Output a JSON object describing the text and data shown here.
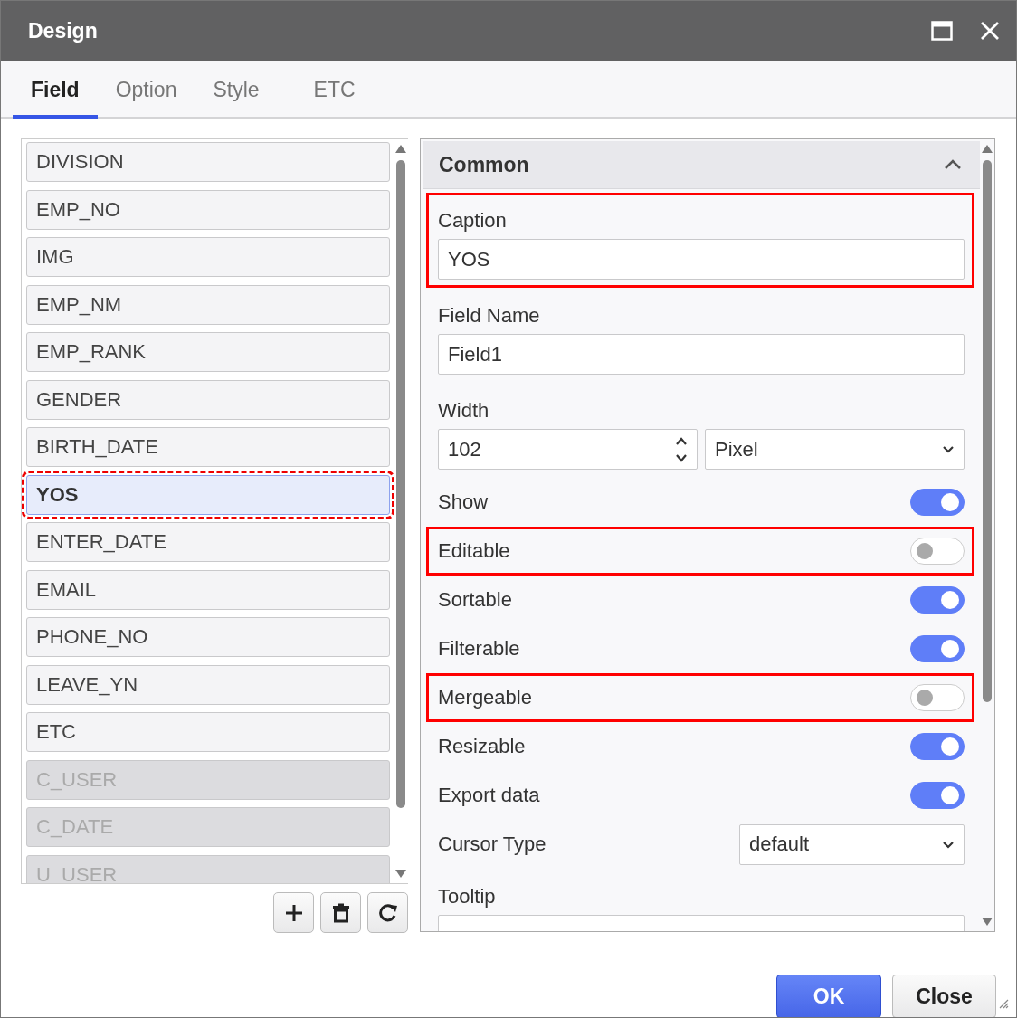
{
  "window": {
    "title": "Design"
  },
  "tabs": [
    {
      "label": "Field",
      "selected": true
    },
    {
      "label": "Option",
      "selected": false
    },
    {
      "label": "Style",
      "selected": false
    },
    {
      "label": "ETC",
      "selected": false
    }
  ],
  "fields": [
    {
      "label": "DIVISION",
      "selected": false,
      "disabled": false,
      "highlighted": false
    },
    {
      "label": "EMP_NO",
      "selected": false,
      "disabled": false,
      "highlighted": false
    },
    {
      "label": "IMG",
      "selected": false,
      "disabled": false,
      "highlighted": false
    },
    {
      "label": "EMP_NM",
      "selected": false,
      "disabled": false,
      "highlighted": false
    },
    {
      "label": "EMP_RANK",
      "selected": false,
      "disabled": false,
      "highlighted": false
    },
    {
      "label": "GENDER",
      "selected": false,
      "disabled": false,
      "highlighted": false
    },
    {
      "label": "BIRTH_DATE",
      "selected": false,
      "disabled": false,
      "highlighted": false
    },
    {
      "label": "YOS",
      "selected": true,
      "disabled": false,
      "highlighted": true
    },
    {
      "label": "ENTER_DATE",
      "selected": false,
      "disabled": false,
      "highlighted": false
    },
    {
      "label": "EMAIL",
      "selected": false,
      "disabled": false,
      "highlighted": false
    },
    {
      "label": "PHONE_NO",
      "selected": false,
      "disabled": false,
      "highlighted": false
    },
    {
      "label": "LEAVE_YN",
      "selected": false,
      "disabled": false,
      "highlighted": false
    },
    {
      "label": "ETC",
      "selected": false,
      "disabled": false,
      "highlighted": false
    },
    {
      "label": "C_USER",
      "selected": false,
      "disabled": true,
      "highlighted": false
    },
    {
      "label": "C_DATE",
      "selected": false,
      "disabled": true,
      "highlighted": false
    },
    {
      "label": "U_USER",
      "selected": false,
      "disabled": true,
      "highlighted": false
    }
  ],
  "section": {
    "title": "Common",
    "expanded": true
  },
  "properties": [
    {
      "kind": "text",
      "label": "Caption",
      "value": "YOS",
      "highlighted": true
    },
    {
      "kind": "text",
      "label": "Field Name",
      "value": "Field1",
      "highlighted": false
    },
    {
      "kind": "width",
      "label": "Width",
      "value": "102",
      "unit": "Pixel",
      "highlighted": false
    },
    {
      "kind": "toggle",
      "label": "Show",
      "on": true,
      "highlighted": false
    },
    {
      "kind": "toggle",
      "label": "Editable",
      "on": false,
      "highlighted": true
    },
    {
      "kind": "toggle",
      "label": "Sortable",
      "on": true,
      "highlighted": false
    },
    {
      "kind": "toggle",
      "label": "Filterable",
      "on": true,
      "highlighted": false
    },
    {
      "kind": "toggle",
      "label": "Mergeable",
      "on": false,
      "highlighted": true
    },
    {
      "kind": "toggle",
      "label": "Resizable",
      "on": true,
      "highlighted": false
    },
    {
      "kind": "toggle",
      "label": "Export data",
      "on": true,
      "highlighted": false
    },
    {
      "kind": "select",
      "label": "Cursor Type",
      "value": "default",
      "highlighted": false
    },
    {
      "kind": "text",
      "label": "Tooltip",
      "highlighted": false
    }
  ],
  "buttons": [
    {
      "label": "OK",
      "kind": "primary"
    },
    {
      "label": "Close",
      "kind": "secondary"
    }
  ]
}
